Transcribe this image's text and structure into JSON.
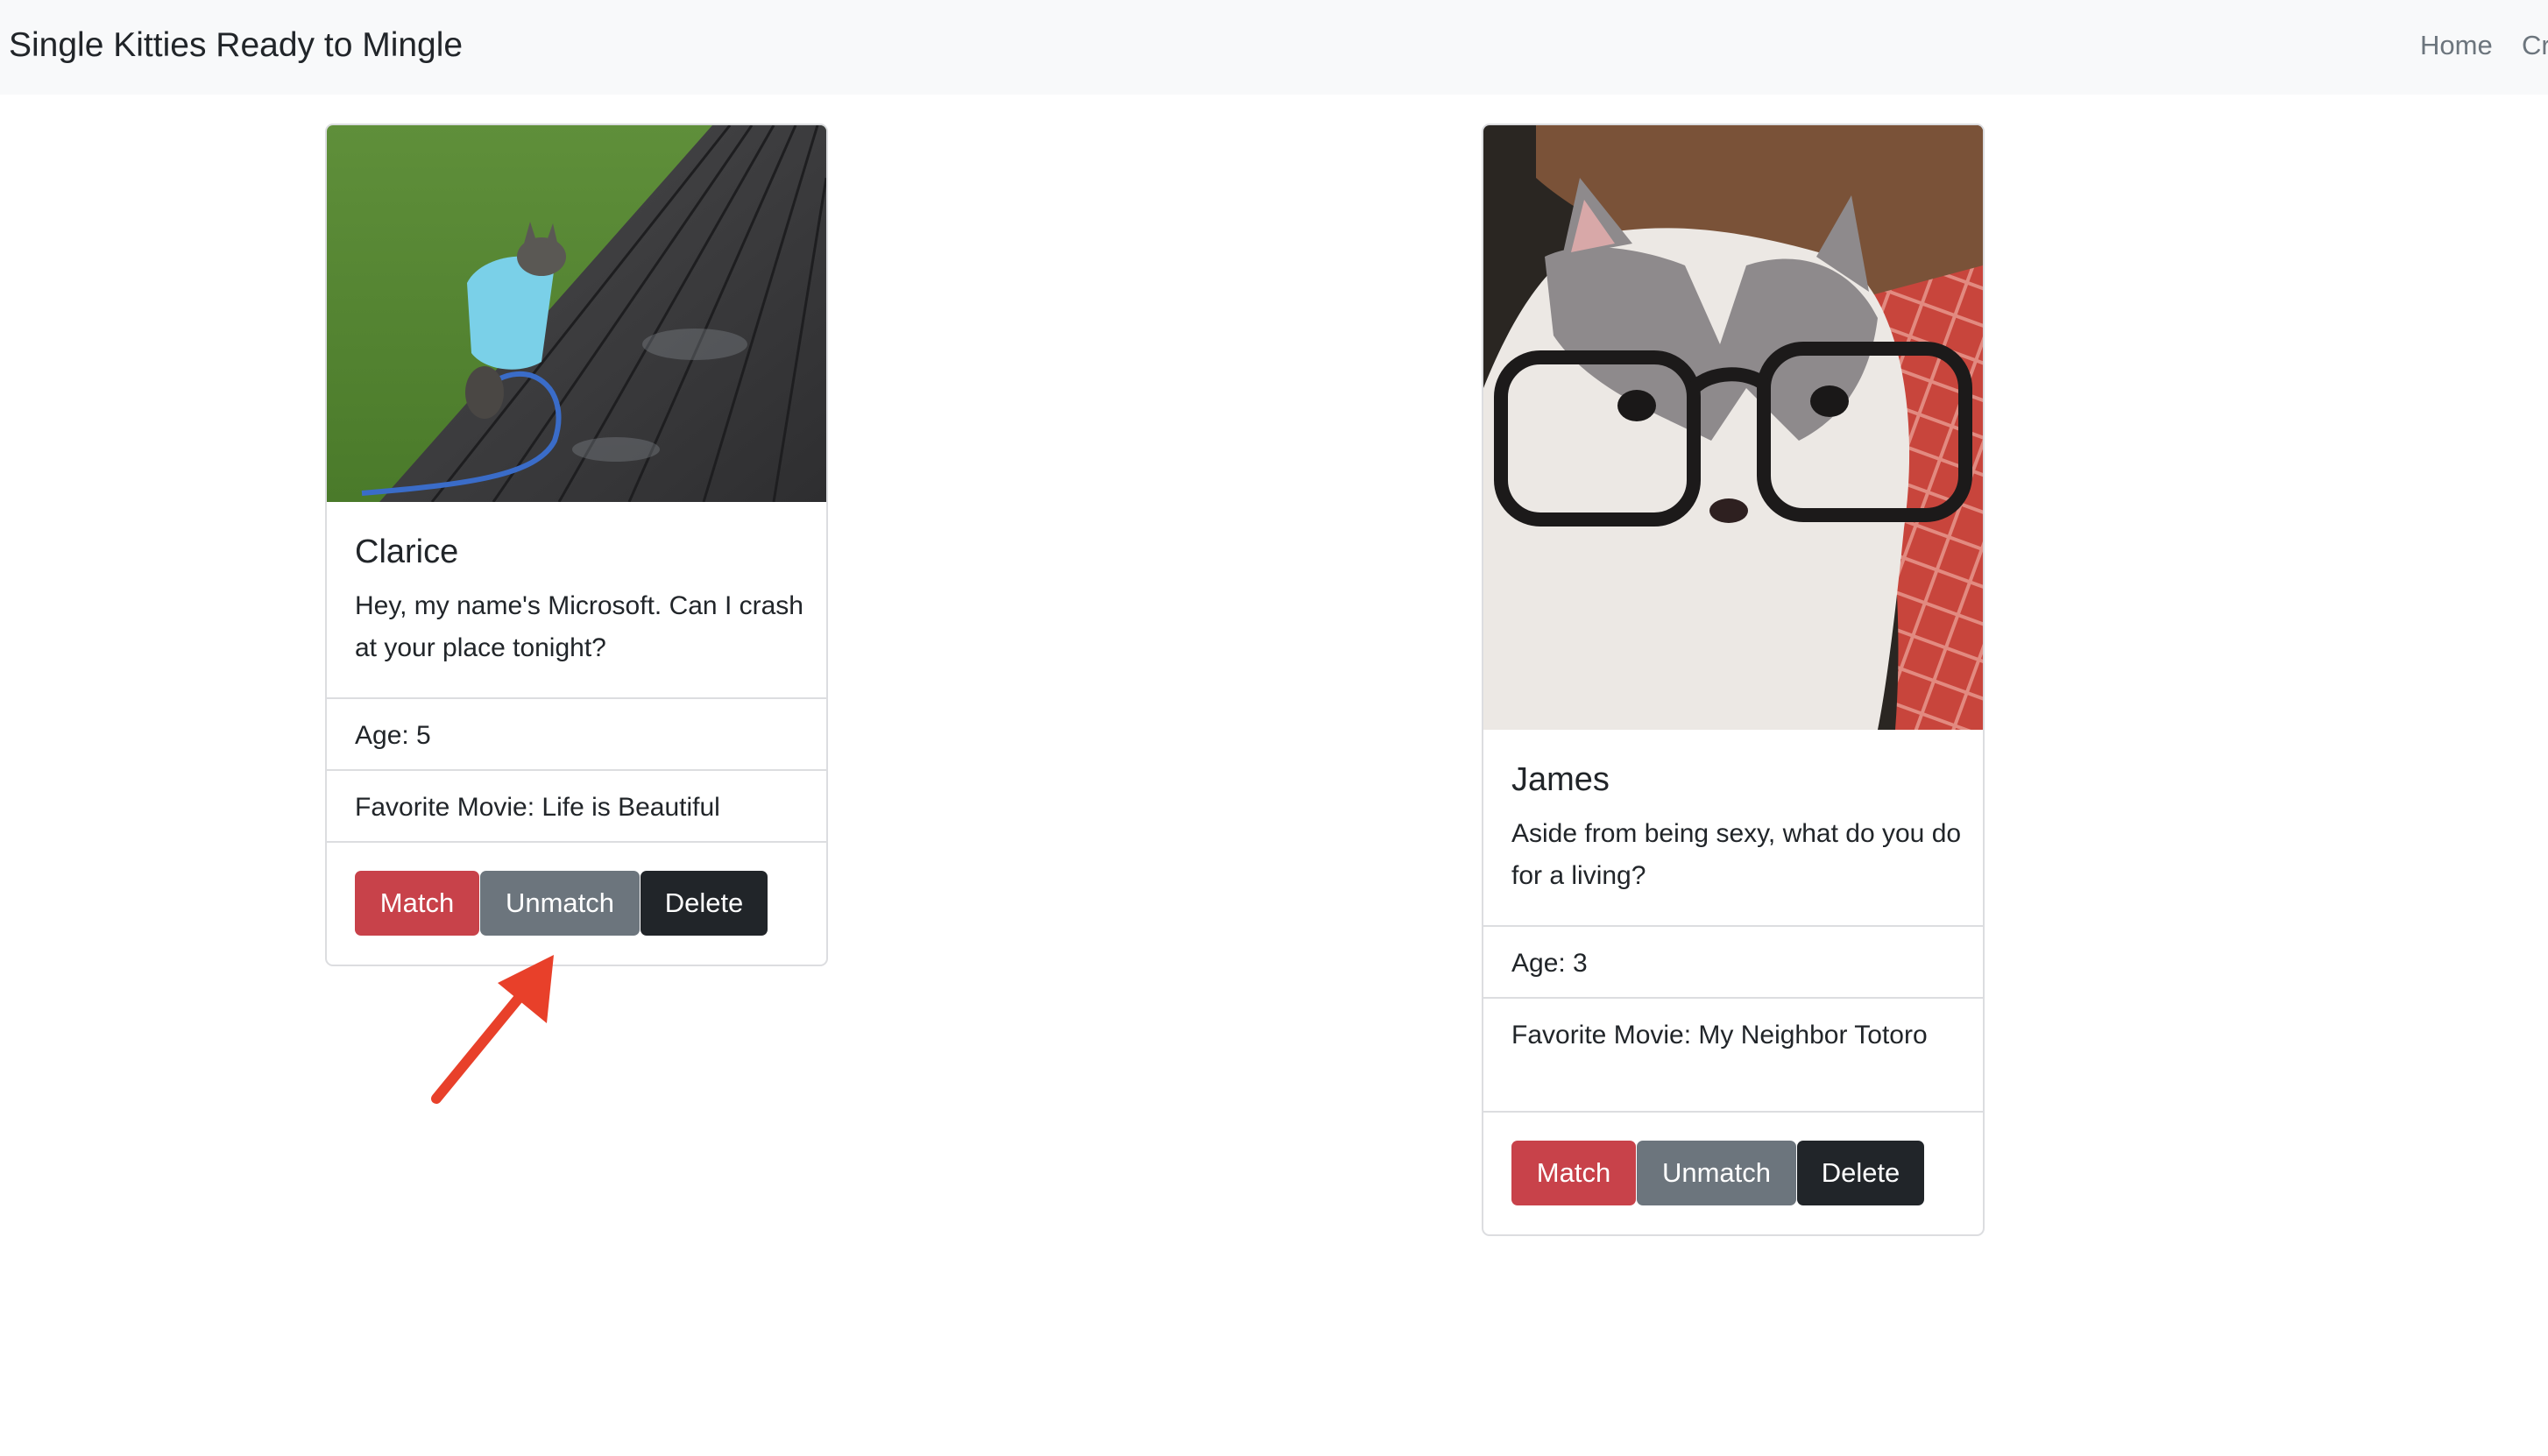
{
  "navbar": {
    "brand": "Single Kitties Ready to Mingle",
    "links": [
      "Home",
      "Cr"
    ]
  },
  "colors": {
    "navbar_bg": "#f8f9fa",
    "match_button": "#c8424a",
    "unmatch_button": "#6c757d",
    "delete_button": "#212529",
    "annotation_arrow": "#e8402a"
  },
  "cards": [
    {
      "name": "Clarice",
      "bio": "Hey, my name's Microsoft. Can I crash at your place tonight?",
      "age": "Age: 5",
      "movie": "Favorite Movie: Life is Beautiful",
      "buttons": {
        "match": "Match",
        "unmatch": "Unmatch",
        "delete": "Delete"
      }
    },
    {
      "name": "James",
      "bio": "Aside from being sexy, what do you do for a living?",
      "age": "Age: 3",
      "movie": "Favorite Movie: My Neighbor Totoro",
      "buttons": {
        "match": "Match",
        "unmatch": "Unmatch",
        "delete": "Delete"
      }
    }
  ]
}
